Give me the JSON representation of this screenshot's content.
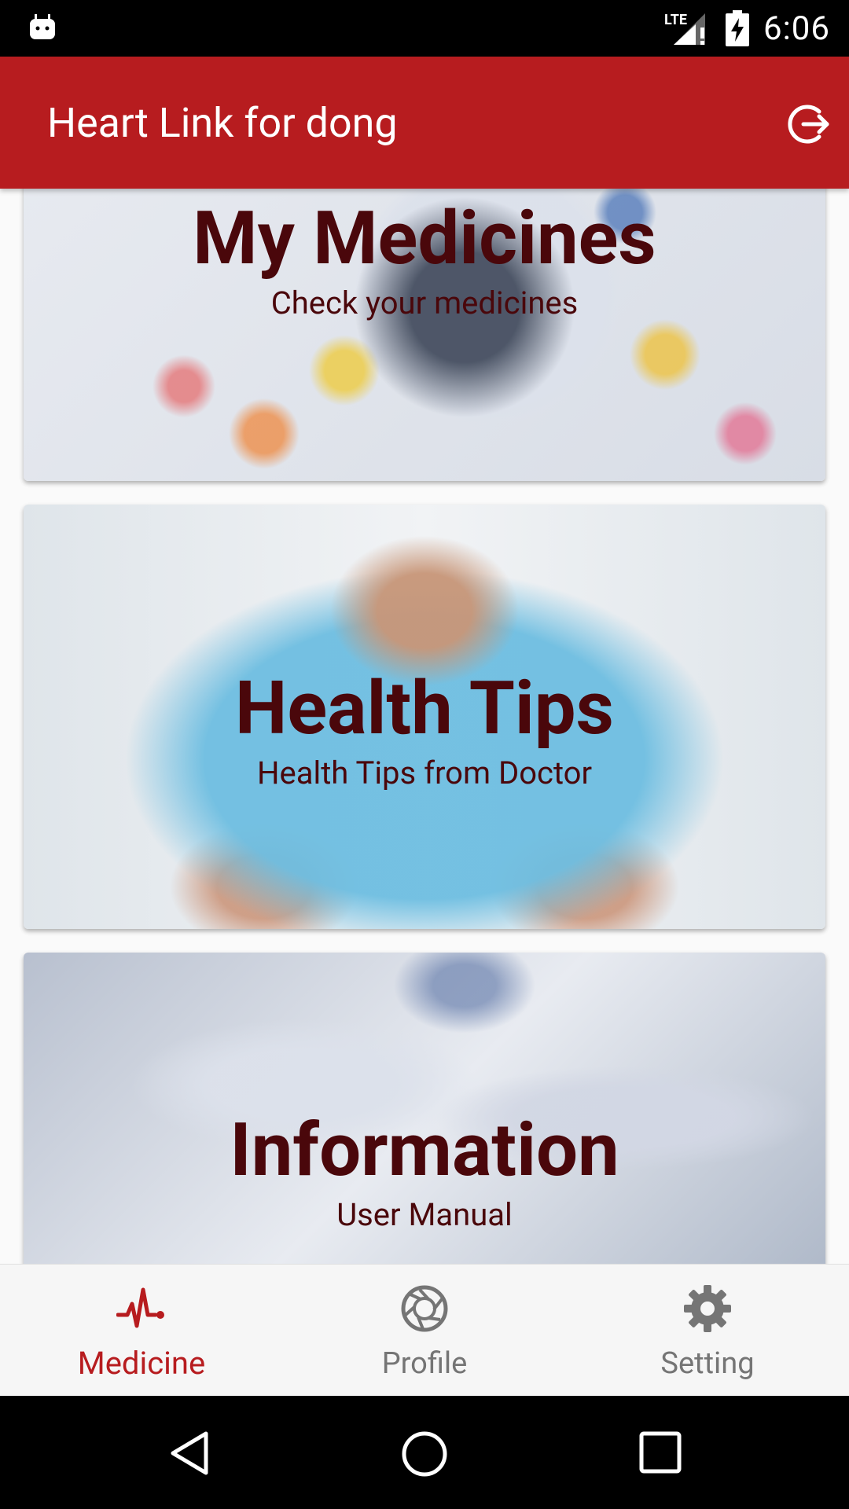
{
  "status_bar": {
    "time": "6:06",
    "network": "LTE"
  },
  "app_bar": {
    "title": "Heart Link for dong",
    "logout_icon": "logout-icon"
  },
  "cards": [
    {
      "title": "My Medicines",
      "subtitle": "Check your medicines"
    },
    {
      "title": "Health Tips",
      "subtitle": "Health Tips from Doctor"
    },
    {
      "title": "Information",
      "subtitle": "User Manual"
    }
  ],
  "bottom_nav": {
    "items": [
      {
        "label": "Medicine",
        "icon": "heartbeat-icon",
        "active": true
      },
      {
        "label": "Profile",
        "icon": "aperture-icon",
        "active": false
      },
      {
        "label": "Setting",
        "icon": "gear-icon",
        "active": false
      }
    ]
  },
  "colors": {
    "primary": "#b71c1f",
    "card_text": "#4a070b",
    "nav_inactive": "#757575"
  }
}
